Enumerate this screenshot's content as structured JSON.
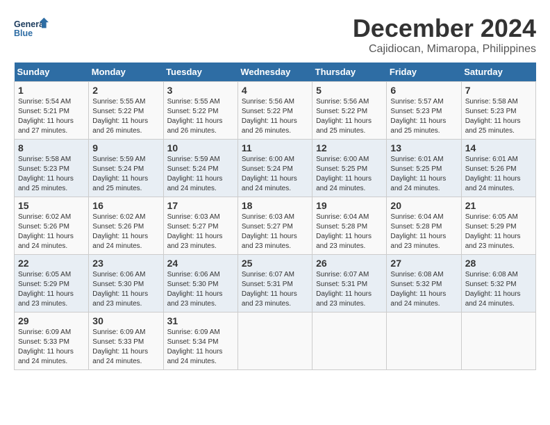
{
  "logo": {
    "line1": "General",
    "line2": "Blue"
  },
  "title": "December 2024",
  "subtitle": "Cajidiocan, Mimaropa, Philippines",
  "headers": [
    "Sunday",
    "Monday",
    "Tuesday",
    "Wednesday",
    "Thursday",
    "Friday",
    "Saturday"
  ],
  "weeks": [
    [
      {
        "day": "1",
        "rise": "Sunrise: 5:54 AM",
        "set": "Sunset: 5:21 PM",
        "daylight": "Daylight: 11 hours and 27 minutes."
      },
      {
        "day": "2",
        "rise": "Sunrise: 5:55 AM",
        "set": "Sunset: 5:22 PM",
        "daylight": "Daylight: 11 hours and 26 minutes."
      },
      {
        "day": "3",
        "rise": "Sunrise: 5:55 AM",
        "set": "Sunset: 5:22 PM",
        "daylight": "Daylight: 11 hours and 26 minutes."
      },
      {
        "day": "4",
        "rise": "Sunrise: 5:56 AM",
        "set": "Sunset: 5:22 PM",
        "daylight": "Daylight: 11 hours and 26 minutes."
      },
      {
        "day": "5",
        "rise": "Sunrise: 5:56 AM",
        "set": "Sunset: 5:22 PM",
        "daylight": "Daylight: 11 hours and 25 minutes."
      },
      {
        "day": "6",
        "rise": "Sunrise: 5:57 AM",
        "set": "Sunset: 5:23 PM",
        "daylight": "Daylight: 11 hours and 25 minutes."
      },
      {
        "day": "7",
        "rise": "Sunrise: 5:58 AM",
        "set": "Sunset: 5:23 PM",
        "daylight": "Daylight: 11 hours and 25 minutes."
      }
    ],
    [
      {
        "day": "8",
        "rise": "Sunrise: 5:58 AM",
        "set": "Sunset: 5:23 PM",
        "daylight": "Daylight: 11 hours and 25 minutes."
      },
      {
        "day": "9",
        "rise": "Sunrise: 5:59 AM",
        "set": "Sunset: 5:24 PM",
        "daylight": "Daylight: 11 hours and 25 minutes."
      },
      {
        "day": "10",
        "rise": "Sunrise: 5:59 AM",
        "set": "Sunset: 5:24 PM",
        "daylight": "Daylight: 11 hours and 24 minutes."
      },
      {
        "day": "11",
        "rise": "Sunrise: 6:00 AM",
        "set": "Sunset: 5:24 PM",
        "daylight": "Daylight: 11 hours and 24 minutes."
      },
      {
        "day": "12",
        "rise": "Sunrise: 6:00 AM",
        "set": "Sunset: 5:25 PM",
        "daylight": "Daylight: 11 hours and 24 minutes."
      },
      {
        "day": "13",
        "rise": "Sunrise: 6:01 AM",
        "set": "Sunset: 5:25 PM",
        "daylight": "Daylight: 11 hours and 24 minutes."
      },
      {
        "day": "14",
        "rise": "Sunrise: 6:01 AM",
        "set": "Sunset: 5:26 PM",
        "daylight": "Daylight: 11 hours and 24 minutes."
      }
    ],
    [
      {
        "day": "15",
        "rise": "Sunrise: 6:02 AM",
        "set": "Sunset: 5:26 PM",
        "daylight": "Daylight: 11 hours and 24 minutes."
      },
      {
        "day": "16",
        "rise": "Sunrise: 6:02 AM",
        "set": "Sunset: 5:26 PM",
        "daylight": "Daylight: 11 hours and 24 minutes."
      },
      {
        "day": "17",
        "rise": "Sunrise: 6:03 AM",
        "set": "Sunset: 5:27 PM",
        "daylight": "Daylight: 11 hours and 23 minutes."
      },
      {
        "day": "18",
        "rise": "Sunrise: 6:03 AM",
        "set": "Sunset: 5:27 PM",
        "daylight": "Daylight: 11 hours and 23 minutes."
      },
      {
        "day": "19",
        "rise": "Sunrise: 6:04 AM",
        "set": "Sunset: 5:28 PM",
        "daylight": "Daylight: 11 hours and 23 minutes."
      },
      {
        "day": "20",
        "rise": "Sunrise: 6:04 AM",
        "set": "Sunset: 5:28 PM",
        "daylight": "Daylight: 11 hours and 23 minutes."
      },
      {
        "day": "21",
        "rise": "Sunrise: 6:05 AM",
        "set": "Sunset: 5:29 PM",
        "daylight": "Daylight: 11 hours and 23 minutes."
      }
    ],
    [
      {
        "day": "22",
        "rise": "Sunrise: 6:05 AM",
        "set": "Sunset: 5:29 PM",
        "daylight": "Daylight: 11 hours and 23 minutes."
      },
      {
        "day": "23",
        "rise": "Sunrise: 6:06 AM",
        "set": "Sunset: 5:30 PM",
        "daylight": "Daylight: 11 hours and 23 minutes."
      },
      {
        "day": "24",
        "rise": "Sunrise: 6:06 AM",
        "set": "Sunset: 5:30 PM",
        "daylight": "Daylight: 11 hours and 23 minutes."
      },
      {
        "day": "25",
        "rise": "Sunrise: 6:07 AM",
        "set": "Sunset: 5:31 PM",
        "daylight": "Daylight: 11 hours and 23 minutes."
      },
      {
        "day": "26",
        "rise": "Sunrise: 6:07 AM",
        "set": "Sunset: 5:31 PM",
        "daylight": "Daylight: 11 hours and 23 minutes."
      },
      {
        "day": "27",
        "rise": "Sunrise: 6:08 AM",
        "set": "Sunset: 5:32 PM",
        "daylight": "Daylight: 11 hours and 24 minutes."
      },
      {
        "day": "28",
        "rise": "Sunrise: 6:08 AM",
        "set": "Sunset: 5:32 PM",
        "daylight": "Daylight: 11 hours and 24 minutes."
      }
    ],
    [
      {
        "day": "29",
        "rise": "Sunrise: 6:09 AM",
        "set": "Sunset: 5:33 PM",
        "daylight": "Daylight: 11 hours and 24 minutes."
      },
      {
        "day": "30",
        "rise": "Sunrise: 6:09 AM",
        "set": "Sunset: 5:33 PM",
        "daylight": "Daylight: 11 hours and 24 minutes."
      },
      {
        "day": "31",
        "rise": "Sunrise: 6:09 AM",
        "set": "Sunset: 5:34 PM",
        "daylight": "Daylight: 11 hours and 24 minutes."
      },
      null,
      null,
      null,
      null
    ]
  ]
}
